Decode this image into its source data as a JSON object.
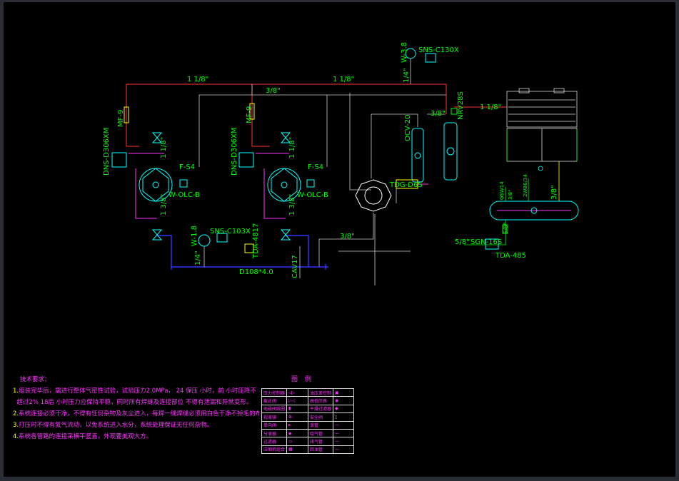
{
  "labels": {
    "pipe_top_left": "1 1/8\"",
    "pipe_top_right": "1 1/8\"",
    "pipe_branch": "3/8\"",
    "pipe_cond": "1 1/8\"",
    "pipe_recv": "3/8\"",
    "pipe_mid": "3/8\"",
    "pipe_liq": "5/8\"",
    "pipe_down1": "1 3/8\"",
    "pipe_down2": "1 3/8\"",
    "pipe_v1": "1 1/8\"",
    "pipe_v2": "1 1/8\"",
    "pipe_w": "1/4\"",
    "pipe_w2": "1/4\"",
    "header_size": "D108*4.0",
    "mf1": "MF-9",
    "mf2": "MF-9",
    "dns1": "DNS-D306XM",
    "dns2": "DNS-D306XM",
    "fs1": "F-S4",
    "fs2": "F-S4",
    "olc1": "W-OLC-B",
    "olc2": "W-OLC-B",
    "sns_top": "SNS-C130X",
    "w38": "W-3.8",
    "w18": "W-1.8",
    "sns_mid": "SNS-C103X",
    "tda1": "TDA-4817",
    "cav": "CAV17",
    "tdg": "TDG-D6S",
    "ocv": "OCV-20",
    "nrv": "NRV28S",
    "sgn": "SGN-16S",
    "tda2": "TDA-485",
    "recv_a": "GSW14",
    "recv_b": "3/8\"",
    "recv_c": "3/8\"",
    "recv_d": "2WB6/34",
    "recv_e": "5/8\""
  },
  "notes": {
    "title": "技术要求：",
    "items": [
      {
        "num": "1.",
        "text": "组装完毕后，需进行整体气密性试验，试验压力2.0MPa，  24    保压     小时，前    小时压降不"
      },
      {
        "num": "",
        "text": "超过2%   18后        小时压力应保持平稳，同时所有焊缝及连接部位  不得有泄漏和异常变形。"
      },
      {
        "num": "2.",
        "text": "系统连接必须干净，不得有任何杂物及灰尘进入，每焊一缝焊缝必须用白色干净不掉毛的布擦净管内杂物。"
      },
      {
        "num": "3.",
        "text": "打压时不得有氮气流动，以免系统进入水分，系统处理保证无任何杂物。"
      },
      {
        "num": "4.",
        "text": "系统各管路的连接采横平竖直，外观要美观大方。"
      }
    ]
  },
  "legend": {
    "title": "图例",
    "rows": [
      {
        "a": "压力控制器",
        "b": "◁▷",
        "c": "油压差控制",
        "d": "▣"
      },
      {
        "a": "截止阀",
        "b": "▷◁",
        "c": "高低压表",
        "d": "◉"
      },
      {
        "a": "电磁阀线圈",
        "b": "▮",
        "c": "干燥过滤器",
        "d": "◆"
      },
      {
        "a": "视液镜",
        "b": "⊗",
        "c": "安全阀",
        "d": "▯"
      },
      {
        "a": "单向阀",
        "b": "▸",
        "c": "液管",
        "d": "—"
      },
      {
        "a": "分液器",
        "b": "▪",
        "c": "吸气管",
        "d": "—"
      },
      {
        "a": "过滤器",
        "b": "▭",
        "c": "排气管",
        "d": "—"
      },
      {
        "a": "压缩机组合",
        "b": "▦",
        "c": "回油管",
        "d": "—"
      }
    ]
  },
  "colors": {
    "background": "#000000",
    "frame": "#2a2d33",
    "refrigerant_line": "#ff3333",
    "suction_line": "#cccccc",
    "magenta_line": "#ff33ff",
    "blue_line": "#3333ff",
    "component": "#00ffff",
    "text": "#00ff00",
    "yellow": "#ffff00"
  }
}
